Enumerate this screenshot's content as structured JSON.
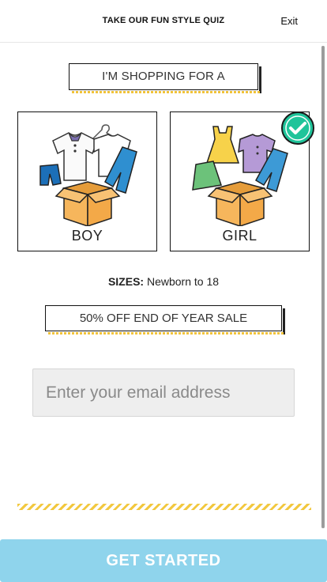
{
  "header": {
    "title": "TAKE OUR FUN STYLE QUIZ",
    "exit_label": "Exit"
  },
  "quiz": {
    "shopping_prompt": "I'M SHOPPING FOR A",
    "choices": [
      {
        "label": "BOY",
        "selected": false,
        "icon": "boy-clothes-box-icon"
      },
      {
        "label": "GIRL",
        "selected": true,
        "icon": "girl-clothes-box-icon"
      }
    ],
    "sizes_label": "SIZES:",
    "sizes_value": " Newborn to 18",
    "sale_banner": "50% OFF END OF YEAR SALE"
  },
  "email": {
    "placeholder": "Enter your email address",
    "value": ""
  },
  "cta": {
    "label": "GET STARTED"
  },
  "colors": {
    "accent_yellow": "#f2c83f",
    "cta_blue": "#8fd4ec",
    "check_green": "#1fc49a",
    "box_orange": "#f6b65c"
  }
}
